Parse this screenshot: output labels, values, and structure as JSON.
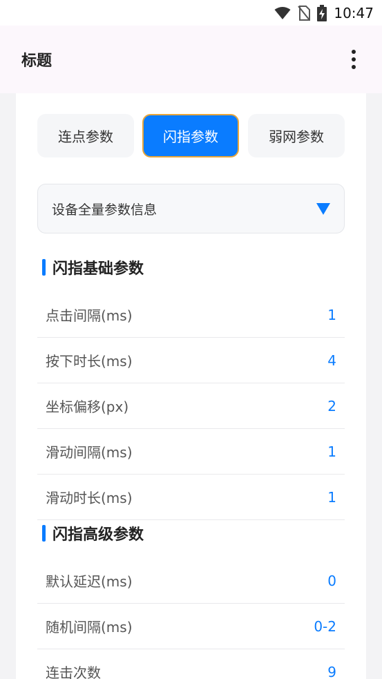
{
  "status_bar": {
    "time": "10:47"
  },
  "app_bar": {
    "title": "标题"
  },
  "tabs": [
    {
      "label": "连点参数",
      "active": false
    },
    {
      "label": "闪指参数",
      "active": true
    },
    {
      "label": "弱网参数",
      "active": false
    }
  ],
  "select": {
    "label": "设备全量参数信息"
  },
  "section_basic": {
    "title": "闪指基础参数",
    "rows": [
      {
        "key": "点击间隔(ms)",
        "value": "1"
      },
      {
        "key": "按下时长(ms)",
        "value": "4"
      },
      {
        "key": "坐标偏移(px)",
        "value": "2"
      },
      {
        "key": "滑动间隔(ms)",
        "value": "1"
      },
      {
        "key": "滑动时长(ms)",
        "value": "1"
      }
    ]
  },
  "section_advanced": {
    "title": "闪指高级参数",
    "rows": [
      {
        "key": "默认延迟(ms)",
        "value": "0"
      },
      {
        "key": "随机间隔(ms)",
        "value": "0-2"
      },
      {
        "key": "连击次数",
        "value": "9"
      }
    ]
  },
  "colors": {
    "accent": "#0a7cff",
    "appbar_bg": "#fcf7fc",
    "tab_outline": "#e8a63a"
  }
}
